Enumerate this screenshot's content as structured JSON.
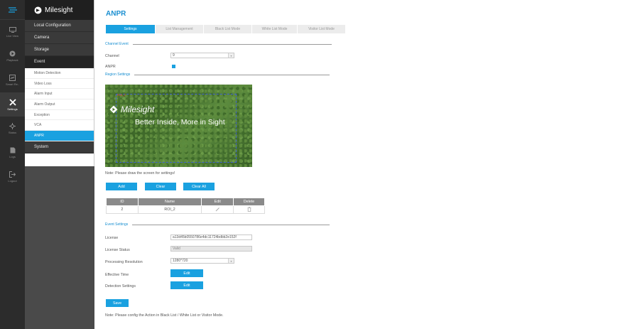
{
  "rail": {
    "items": [
      {
        "label": "Live View",
        "icon": "live-view-icon"
      },
      {
        "label": "Playback",
        "icon": "playback-icon"
      },
      {
        "label": "Smart Re..",
        "icon": "smart-search-icon"
      },
      {
        "label": "Settings",
        "icon": "settings-icon"
      },
      {
        "label": "Status",
        "icon": "status-icon"
      },
      {
        "label": "Logs",
        "icon": "logs-icon"
      },
      {
        "label": "Logout",
        "icon": "logout-icon"
      }
    ],
    "active": "Settings"
  },
  "brand": {
    "name": "Milesight"
  },
  "menu": {
    "local_configuration": "Local Configuration",
    "camera": "Camera",
    "storage": "Storage",
    "event": "Event",
    "event_items": [
      "Motion Detection",
      "Video Loss",
      "Alarm Input",
      "Alarm Output",
      "Exception",
      "VCA",
      "ANPR"
    ],
    "active_item": "ANPR",
    "system": "System"
  },
  "page": {
    "title": "ANPR",
    "tabs": [
      "Settings",
      "List Management",
      "Black List Mode",
      "White List Mode",
      "Visitor List Mode"
    ],
    "active_tab": "Settings"
  },
  "channel_event": {
    "section": "Channel Event",
    "channel_label": "Channel",
    "channel_value": "9",
    "anpr_label": "ANPR",
    "anpr_checked": true
  },
  "region": {
    "section": "Region Settings",
    "roi_tag": "ROI_2",
    "watermark_brand": "Milesight",
    "watermark_slogan": "Better Inside, More in Sight",
    "note": "Note: Please draw the screen for settings!",
    "buttons": {
      "add": "Add",
      "clear": "Clear",
      "clear_all": "Clear All"
    },
    "table": {
      "headers": [
        "ID",
        "Name",
        "Edit",
        "Delete"
      ],
      "rows": [
        {
          "id": "2",
          "name": "ROI_2"
        }
      ]
    }
  },
  "event_settings": {
    "section": "Event Settings",
    "license_label": "License",
    "license_value": "a13d45b0550786e4dc11724bdbb2e152f",
    "license_status_label": "License Status",
    "license_status_value": "Valid",
    "processing_resolution_label": "Processing Resolution",
    "processing_resolution_value": "1280*720",
    "effective_time_label": "Effective Time",
    "effective_time_button": "Edit",
    "detection_settings_label": "Detection Settings",
    "detection_settings_button": "Edit"
  },
  "footer": {
    "save": "Save",
    "note": "Note: Please config the Action in Black List / White List or Visitor Mode."
  },
  "colors": {
    "accent": "#1aa1e0",
    "title": "#1a8fd1",
    "rail": "#2c2c2c",
    "menu_dark": "#3a3a3a"
  }
}
